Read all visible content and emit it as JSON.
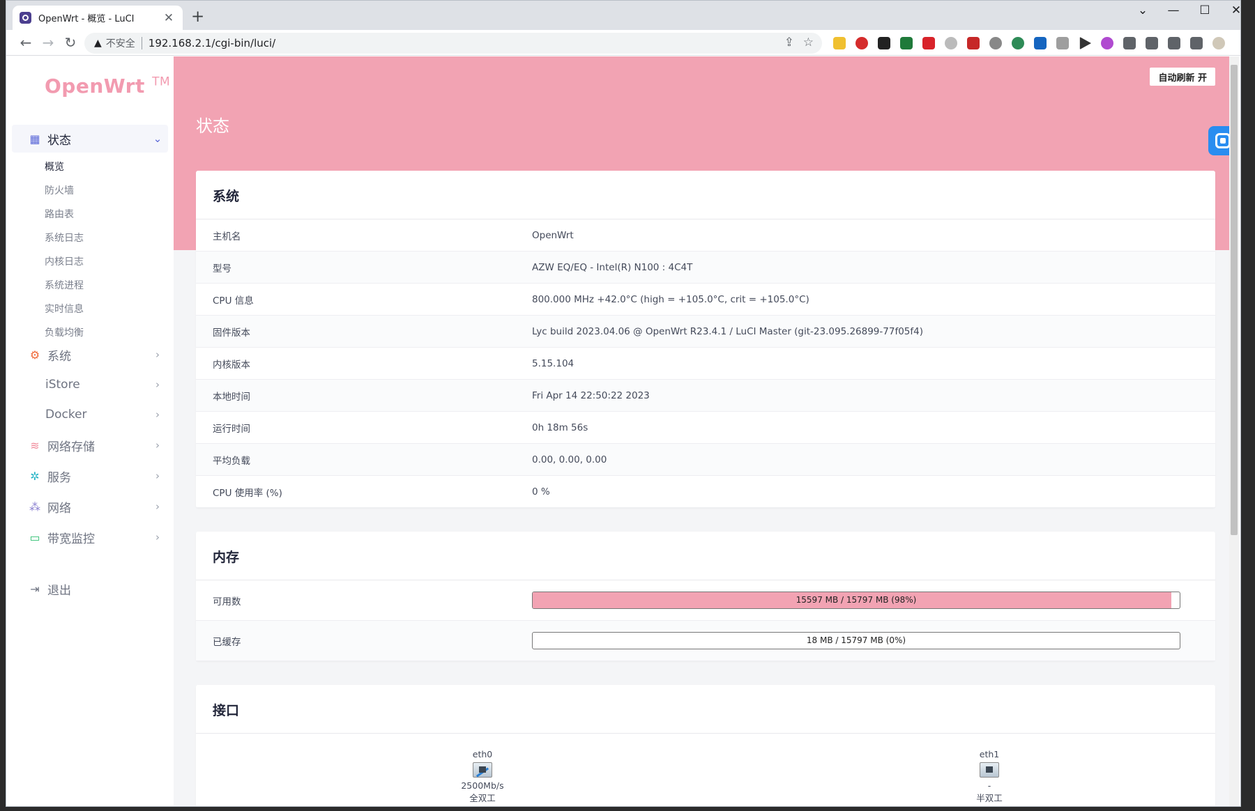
{
  "browser": {
    "tab_title": "OpenWrt - 概览 - LuCI",
    "tab_close": "✕",
    "new_tab": "+",
    "insecure_label": "不安全",
    "url": "192.168.2.1/cgi-bin/luci/"
  },
  "sidebar": {
    "logo": "OpenWrt",
    "logo_tm": "TM",
    "items": [
      {
        "label": "状态",
        "icon": "dashboard-icon",
        "color": "#5a67d8"
      },
      {
        "label": "系统",
        "icon": "gear-icon",
        "color": "#f06a3a"
      },
      {
        "label": "iStore",
        "icon": "",
        "color": ""
      },
      {
        "label": "Docker",
        "icon": "",
        "color": ""
      },
      {
        "label": "网络存储",
        "icon": "database-icon",
        "color": "#f08a9a"
      },
      {
        "label": "服务",
        "icon": "cogs-icon",
        "color": "#2bb6c8"
      },
      {
        "label": "网络",
        "icon": "sitemap-icon",
        "color": "#8a7fd0"
      },
      {
        "label": "带宽监控",
        "icon": "monitor-icon",
        "color": "#2fbf71"
      },
      {
        "label": "退出",
        "icon": "logout-icon",
        "color": "#6e7381"
      }
    ],
    "status_sub": [
      "概览",
      "防火墙",
      "路由表",
      "系统日志",
      "内核日志",
      "系统进程",
      "实时信息",
      "负载均衡"
    ]
  },
  "header": {
    "auto_refresh": "自动刷新 开",
    "page_title": "状态"
  },
  "system": {
    "title": "系统",
    "rows": [
      {
        "k": "主机名",
        "v": "OpenWrt"
      },
      {
        "k": "型号",
        "v": "AZW EQ/EQ - Intel(R) N100 : 4C4T"
      },
      {
        "k": "CPU 信息",
        "v": "800.000 MHz +42.0°C (high = +105.0°C, crit = +105.0°C)"
      },
      {
        "k": "固件版本",
        "v": "Lyc build 2023.04.06 @ OpenWrt R23.4.1 / LuCI Master (git-23.095.26899-77f05f4)"
      },
      {
        "k": "内核版本",
        "v": "5.15.104"
      },
      {
        "k": "本地时间",
        "v": "Fri Apr 14 22:50:22 2023"
      },
      {
        "k": "运行时间",
        "v": "0h 18m 56s"
      },
      {
        "k": "平均负载",
        "v": "0.00, 0.00, 0.00"
      },
      {
        "k": "CPU 使用率 (%)",
        "v": "0 %"
      }
    ]
  },
  "memory": {
    "title": "内存",
    "rows": [
      {
        "k": "可用数",
        "text": "15597 MB / 15797 MB (98%)",
        "fraction": 0.987
      },
      {
        "k": "已缓存",
        "text": "18 MB / 15797 MB (0%)",
        "fraction": 0.0
      }
    ]
  },
  "interfaces": {
    "title": "接口",
    "ports": [
      {
        "name": "eth0",
        "speed": "2500Mb/s",
        "duplex": "全双工",
        "link": true
      },
      {
        "name": "eth1",
        "speed": "-",
        "duplex": "半双工",
        "link": false
      }
    ]
  }
}
